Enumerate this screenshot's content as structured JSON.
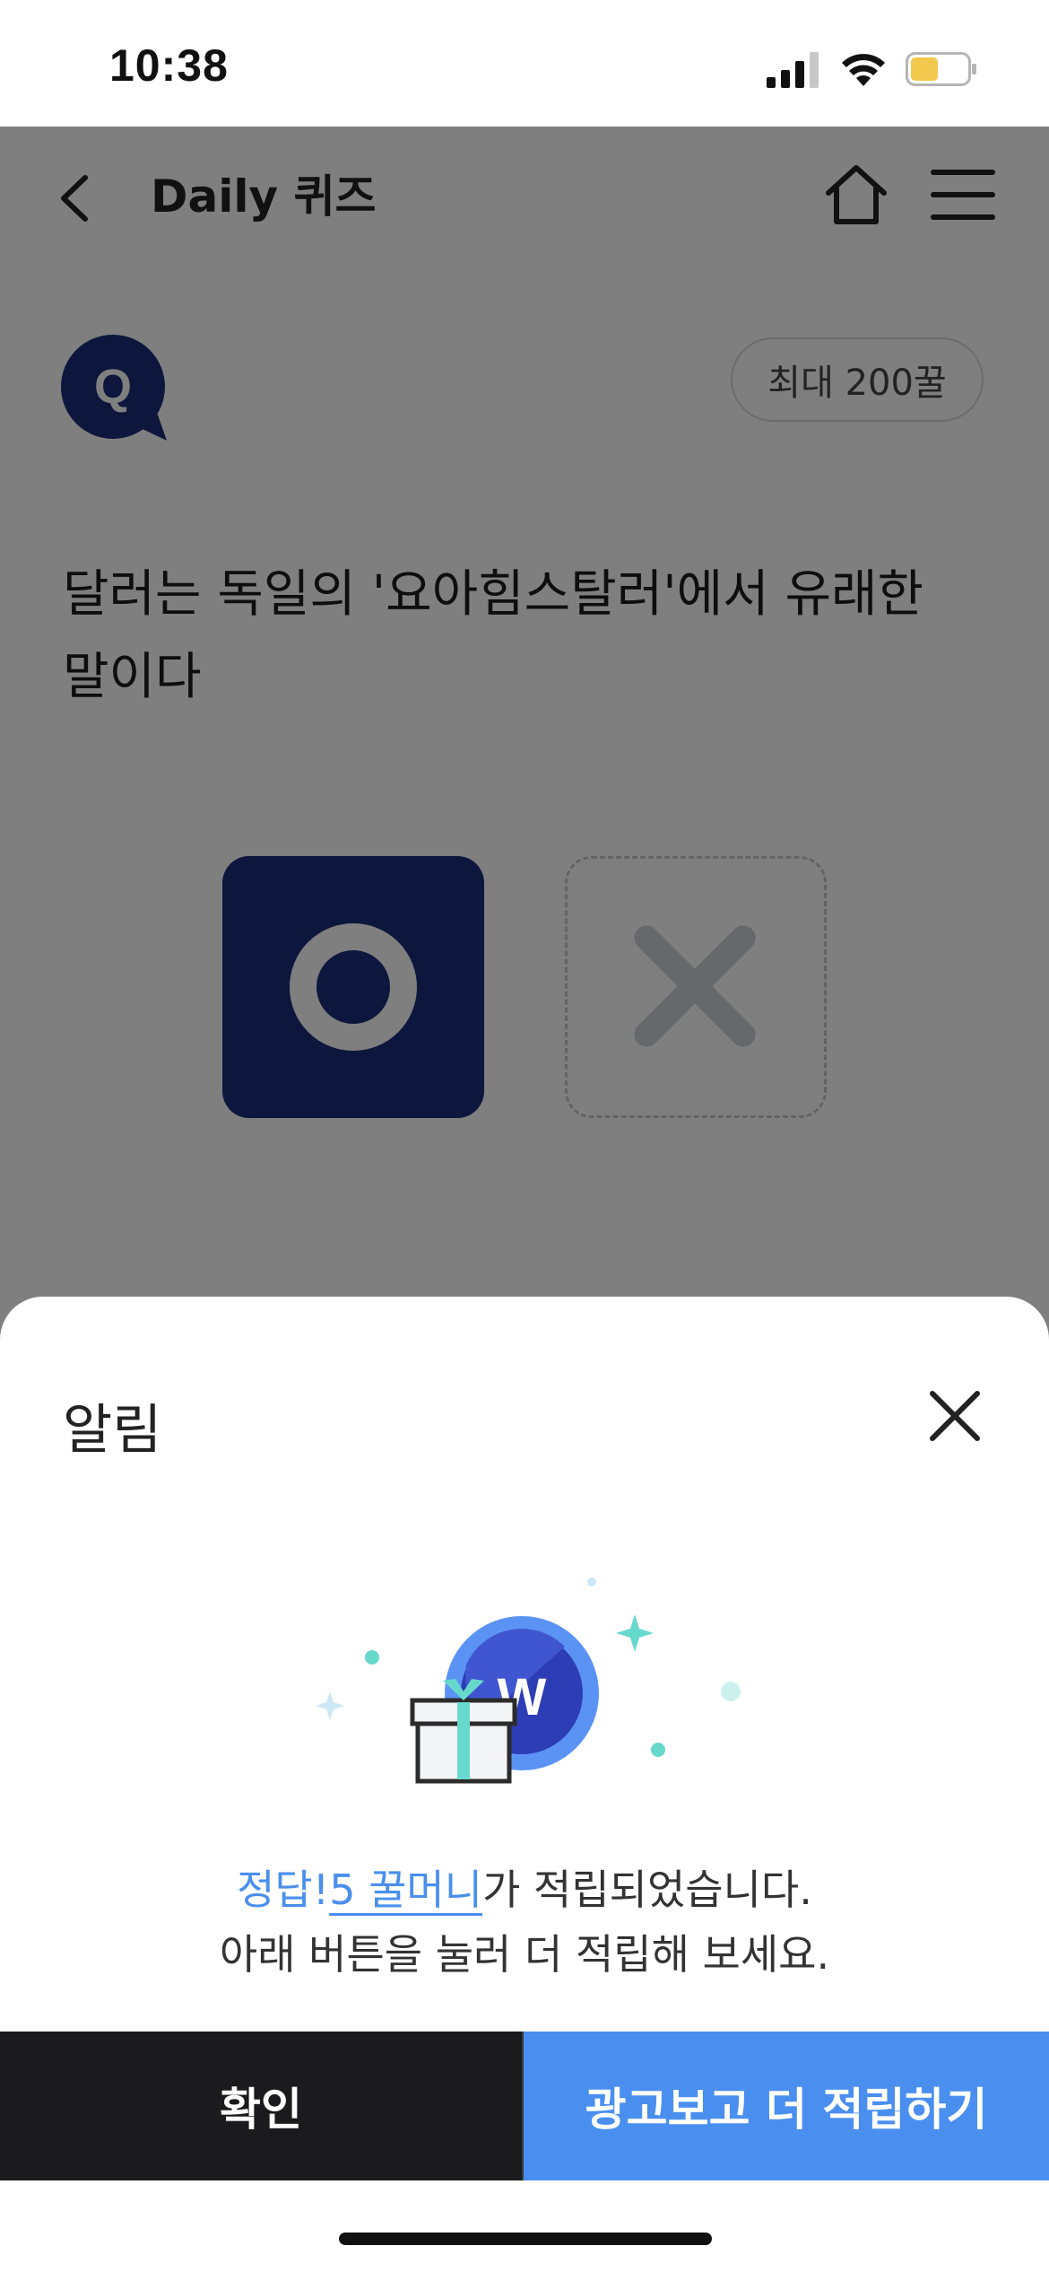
{
  "status_bar": {
    "time": "10:38",
    "battery_color": "#f2c94c"
  },
  "nav": {
    "back_icon": "chevron-left-icon",
    "title": "Daily 퀴즈",
    "home_icon": "home-icon",
    "menu_icon": "hamburger-menu-icon"
  },
  "quiz": {
    "badge_letter": "Q",
    "max_reward": "최대 200꿀",
    "question_line1": "달러는 독일의 '요아힘스탈러'에서 유래한",
    "question_line2": "말이다",
    "option_o_icon": "circle-o-icon",
    "option_x_icon": "cross-x-icon",
    "selected": "O",
    "brand_color": "#1a2e7a"
  },
  "alert_sheet": {
    "title": "알림",
    "close_icon": "close-icon",
    "illustration_letter": "W",
    "message_correct": "정답!",
    "message_reward": "5 꿀머니",
    "message_rest": "가 적립되었습니다.",
    "message_line2": "아래 버튼을 눌러 더 적립해 보세요.",
    "confirm_label": "확인",
    "ad_label": "광고보고 더 적립하기",
    "accent_color": "#4a8ff0"
  }
}
